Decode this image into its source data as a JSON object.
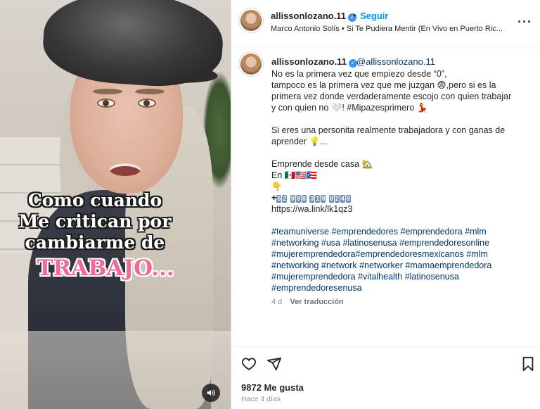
{
  "video": {
    "caption_lines": [
      "Como cuando",
      "Me critican por",
      "cambiarme de"
    ],
    "caption_accent": "TRABAJO...",
    "mute_icon": "speaker-icon"
  },
  "header": {
    "username": "allissonlozano.11",
    "dot": "•",
    "follow_label": "Seguir",
    "song": "Marco Antonio Solís • Si Te Pudiera Mentir (En Vivo en Puerto Ric...",
    "more_icon": "ellipsis-icon",
    "more_label": "···"
  },
  "post": {
    "username": "allissonlozano.11",
    "handle": "@allissonlozano.11",
    "paragraph1": "No es la primera vez que empiezo desde “0”,\ntampoco es la primera vez que me juzgan 😨,pero si es la\nprimera vez donde verdaderamente escojo con quien trabajar\ny con quien no 🤍! #Mipazesprimero 💃",
    "paragraph2": "Si eres una personita realmente trabajadora y con ganas de\naprender 💡...",
    "emprende_line1": "Emprende desde casa 🏡",
    "emprende_line2": "En 🇲🇽🇺🇸🇵🇷",
    "pointer": "👇",
    "phone_prefix": "+",
    "phone_digits": [
      "5",
      "2",
      "9",
      "9",
      "8",
      "3",
      "1",
      "9",
      "8",
      "2",
      "4",
      "9"
    ],
    "link": "https://wa.link/lk1qz3",
    "hashtags": "#teamuniverse #emprendedores #emprendedora #mlm\n#networking #usa #latinosenusa #emprendedoresonline\n#mujeremprendedora#emprendedoresmexicanos #mlm\n#networking #network #networker #mamaemprendedora\n#mujeremprendedora #vitalhealth #latinosenusa\n#emprendedoresenusa",
    "time": "4 d",
    "translate_label": "Ver traducción"
  },
  "actions": {
    "heart_icon": "heart-icon",
    "share_icon": "send-icon",
    "save_icon": "bookmark-icon",
    "likes": "9872 Me gusta",
    "posted_ago": "Hace 4 días"
  }
}
